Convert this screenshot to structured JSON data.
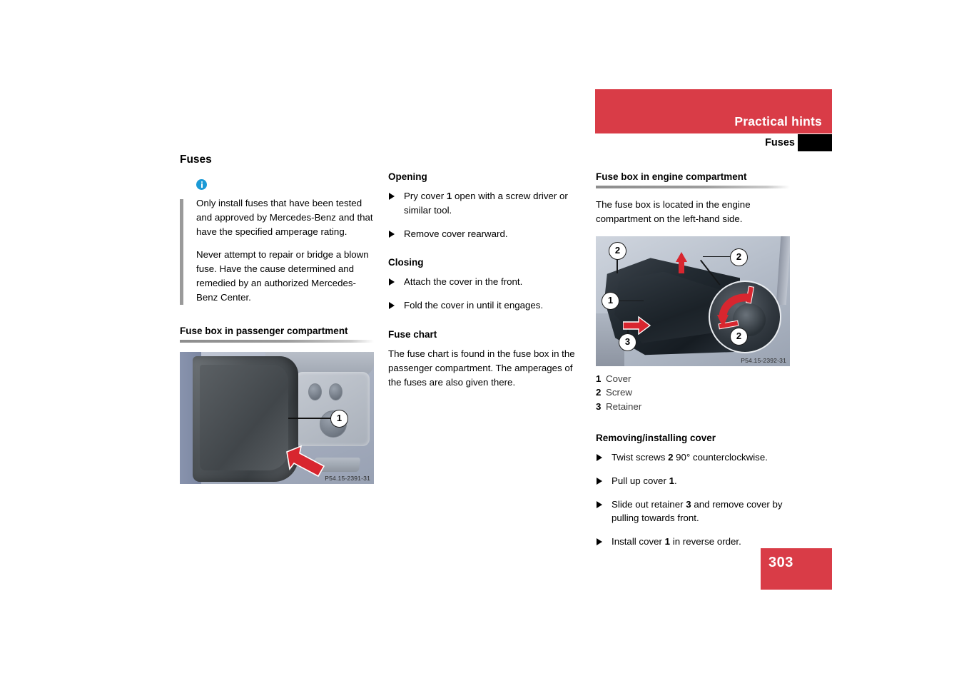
{
  "header": {
    "banner_title": "Practical hints",
    "subtitle": "Fuses"
  },
  "page": {
    "number": "303"
  },
  "left_column": {
    "title": "Fuses",
    "note": {
      "icon": "info-icon",
      "paragraphs": [
        "Only install fuses that have been tested and approved by Mercedes-Benz and that have the specified amperage rating.",
        "Never attempt to repair or bridge a blown fuse. Have the cause determined and remedied by an authorized Mercedes-Benz Center."
      ]
    },
    "section": {
      "heading": "Fuse box in passenger compartment",
      "figure": {
        "caption": "P54.15-2391-31",
        "callouts": [
          "1"
        ]
      }
    }
  },
  "middle_column": {
    "opening": {
      "heading": "Opening",
      "steps": [
        {
          "pre": "Pry cover ",
          "ref": "1",
          "post": " open with a screw driver or similar tool."
        },
        {
          "pre": "Remove cover rearward.",
          "ref": "",
          "post": ""
        }
      ]
    },
    "closing": {
      "heading": "Closing",
      "steps": [
        {
          "pre": "Attach the cover in the front.",
          "ref": "",
          "post": ""
        },
        {
          "pre": "Fold the cover in until it engages.",
          "ref": "",
          "post": ""
        }
      ]
    },
    "fuse_chart": {
      "heading": "Fuse chart",
      "body": "The fuse chart is found in the fuse box in the passenger compartment. The amperages of the fuses are also given there."
    }
  },
  "right_column": {
    "section": {
      "heading": "Fuse box in engine compartment",
      "body": "The fuse box is located in the engine compartment on the left-hand side."
    },
    "figure": {
      "caption": "P54.15-2392-31",
      "callouts": [
        "2",
        "2",
        "1",
        "3",
        "2"
      ]
    },
    "legend": [
      {
        "num": "1",
        "label": "Cover"
      },
      {
        "num": "2",
        "label": "Screw"
      },
      {
        "num": "3",
        "label": "Retainer"
      }
    ],
    "removing": {
      "heading": "Removing/installing cover",
      "steps": [
        {
          "pre": "Twist screws ",
          "ref": "2",
          "post": " 90° counterclockwise."
        },
        {
          "pre": "Pull up cover ",
          "ref": "1",
          "post": "."
        },
        {
          "pre": "Slide out retainer ",
          "ref": "3",
          "post": " and remove cover by pulling towards front."
        },
        {
          "pre": "Install cover ",
          "ref": "1",
          "post": " in reverse order."
        }
      ]
    }
  },
  "colors": {
    "accent_red": "#d93c47",
    "info_blue": "#1b9ad6",
    "rule_gray": "#9a9a9a"
  }
}
